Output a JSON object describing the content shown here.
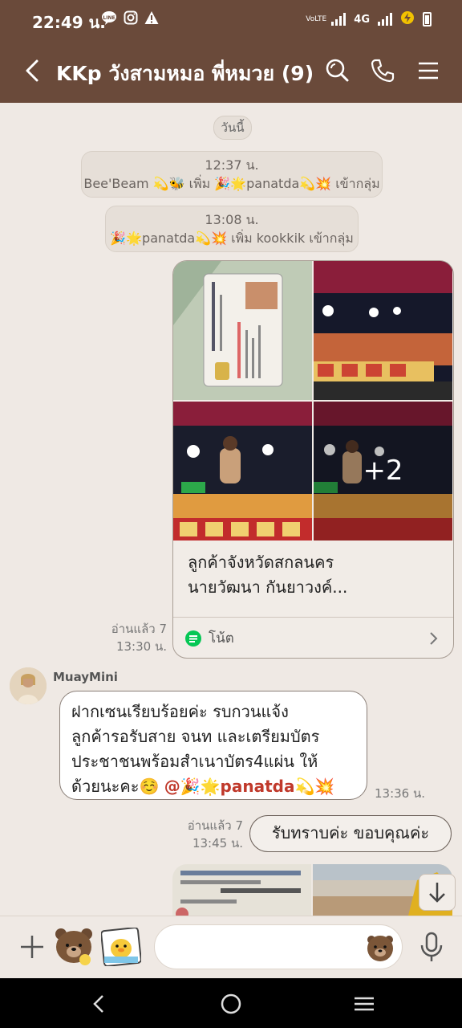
{
  "status": {
    "time": "22:49 น.",
    "network": "4G",
    "volte": "VoLTE"
  },
  "header": {
    "title": "KKp วังสามหมอ พี่หมวย (9)"
  },
  "chat": {
    "date_label": "วันนี้",
    "system_messages": [
      {
        "time": "12:37 น.",
        "text": "Bee'Beam 💫🐝 เพิ่ม 🎉🌟panatda💫💥 เข้ากลุ่ม"
      },
      {
        "time": "13:08 น.",
        "text": "🎉🌟panatda💫💥 เพิ่ม kookkik เข้ากลุ่ม"
      }
    ],
    "album": {
      "more_count": "+2",
      "caption_line1": "ลูกค้าจังหวัดสกลนคร",
      "caption_line2": "นายวัฒนา กันยาวงค์...",
      "note_label": "โน้ต",
      "read_label": "อ่านแล้ว 7",
      "time": "13:30 น."
    },
    "incoming": {
      "sender": "MuayMini",
      "line1": "ฝากเซนเรียบร้อยค่ะ รบกวนแจ้ง",
      "line2": "ลูกค้ารอรับสาย จนท และเตรียมบัตร",
      "line3": "ประชาชนพร้อมสำเนาบัตร4แผ่น ให้",
      "line4_prefix": "ด้วยนะคะ☺️ ",
      "mention": "@🎉🌟panatda💫💥",
      "time": "13:36 น."
    },
    "outgoing": {
      "text": "รับทราบค่ะ ขอบคุณค่ะ",
      "read_label": "อ่านแล้ว 7",
      "time": "13:45 น."
    }
  },
  "input": {
    "placeholder": ""
  },
  "colors": {
    "header_bg": "#6a4a3a",
    "chat_bg": "#efe9e4",
    "mention": "#c0392b",
    "line_green": "#06c755"
  }
}
